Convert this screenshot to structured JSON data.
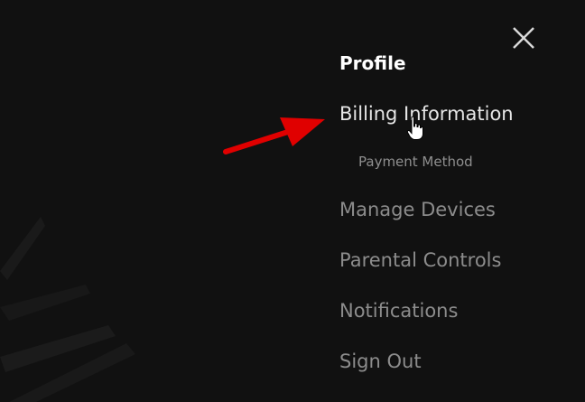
{
  "menu": {
    "items": [
      {
        "label": "Profile"
      },
      {
        "label": "Billing Information"
      },
      {
        "label": "Payment Method"
      },
      {
        "label": "Manage Devices"
      },
      {
        "label": "Parental Controls"
      },
      {
        "label": "Notifications"
      },
      {
        "label": "Sign Out"
      }
    ]
  },
  "icons": {
    "close": "close-icon",
    "arrow": "red-arrow-annotation",
    "cursor": "hand-cursor-icon"
  },
  "colors": {
    "background": "#111111",
    "active_text": "#ffffff",
    "hover_text": "#e6e6e6",
    "inactive_text": "#8c8c8c",
    "annotation": "#e00000"
  }
}
